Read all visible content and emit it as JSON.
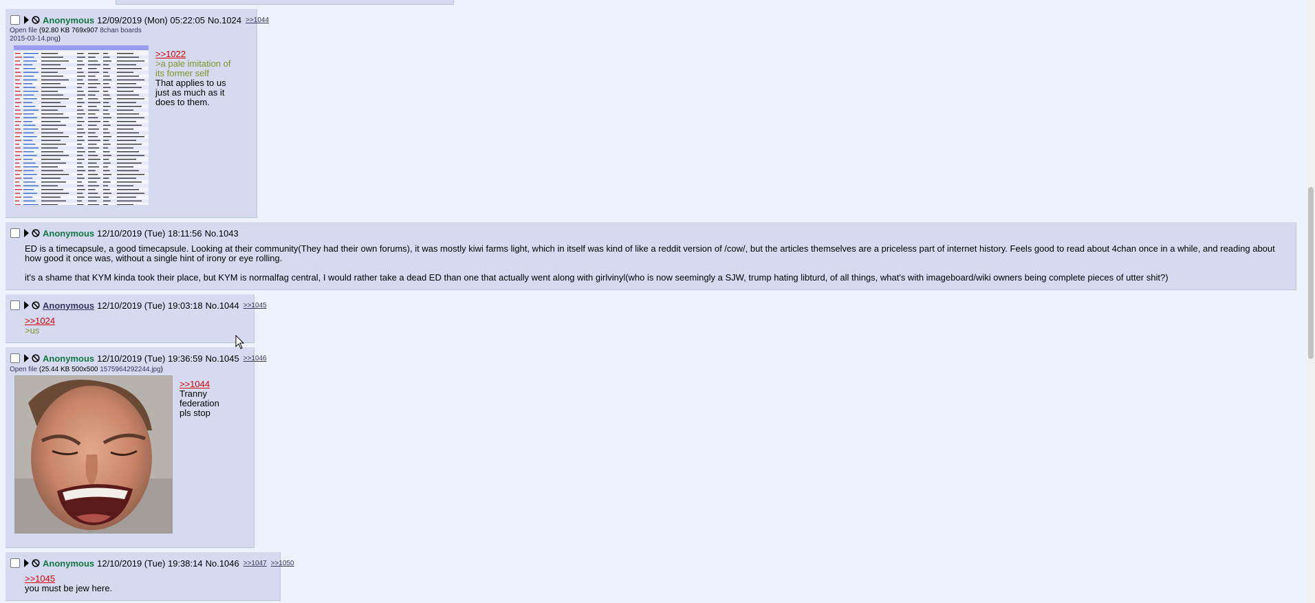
{
  "posts": [
    {
      "name": "Anonymous",
      "date": "12/09/2019 (Mon) 05:22:05",
      "no": "No.1024",
      "backlinks": [
        ">>1044"
      ],
      "file": {
        "open": "Open file",
        "size": "92.80 KB 769x907",
        "filename_a": "8chan boards",
        "filename_b": "2015-03-14.png"
      },
      "lines": [
        {
          "type": "quote",
          "text": ">>1022"
        },
        {
          "type": "green",
          "text": ">a pale imitation of"
        },
        {
          "type": "green",
          "text": "its former self"
        },
        {
          "type": "text",
          "text": "That applies to us"
        },
        {
          "type": "text",
          "text": "just as much as it"
        },
        {
          "type": "text",
          "text": "does to them."
        }
      ]
    },
    {
      "name": "Anonymous",
      "date": "12/10/2019 (Tue) 18:11:56",
      "no": "No.1043",
      "backlinks": [],
      "paragraphs": [
        "ED is a timecapsule, a good timecapsule. Looking at their community(They had their own forums), it was mostly kiwi farms light, which in itself was kind of like a reddit version of /cow/, but the articles themselves are a priceless part of internet history. Feels good to read about 4chan once in a while, and reading about how good it once was, without a single hint of irony or eye rolling.",
        "it's a shame that KYM kinda took their place, but KYM is normalfag central, I would rather take a dead ED than one that actually went along with girlvinyl(who is now seemingly a SJW, trump hating libturd, of all things, what's with imageboard/wiki owners being complete pieces of utter shit?)"
      ]
    },
    {
      "name": "Anonymous",
      "date": "12/10/2019 (Tue) 19:03:18",
      "no": "No.1044",
      "backlinks": [
        ">>1045"
      ],
      "lines": [
        {
          "type": "quote",
          "text": ">>1024"
        },
        {
          "type": "green",
          "text": ">us"
        }
      ]
    },
    {
      "name": "Anonymous",
      "date": "12/10/2019 (Tue) 19:36:59",
      "no": "No.1045",
      "backlinks": [
        ">>1046"
      ],
      "file": {
        "open": "Open file",
        "size": "25.44 KB 500x500",
        "filename_a": "1575964292244.jpg",
        "filename_b": ""
      },
      "lines": [
        {
          "type": "quote",
          "text": ">>1044"
        },
        {
          "type": "text",
          "text": "Tranny"
        },
        {
          "type": "text",
          "text": "federation"
        },
        {
          "type": "text",
          "text": "pls stop"
        }
      ]
    },
    {
      "name": "Anonymous",
      "date": "12/10/2019 (Tue) 19:38:14",
      "no": "No.1046",
      "backlinks": [
        ">>1047",
        ">>1050"
      ],
      "lines": [
        {
          "type": "quote",
          "text": ">>1045"
        },
        {
          "type": "text",
          "text": "you must be jew here."
        }
      ]
    }
  ],
  "colors": {
    "bg": "#eef2ff",
    "reply": "#d6daf0",
    "name": "#117743",
    "quote": "#dd0000",
    "green": "#789922",
    "link": "#34345c"
  },
  "icons": [
    "expand-triangle-icon",
    "hide-post-icon",
    "mouse-cursor-icon"
  ]
}
